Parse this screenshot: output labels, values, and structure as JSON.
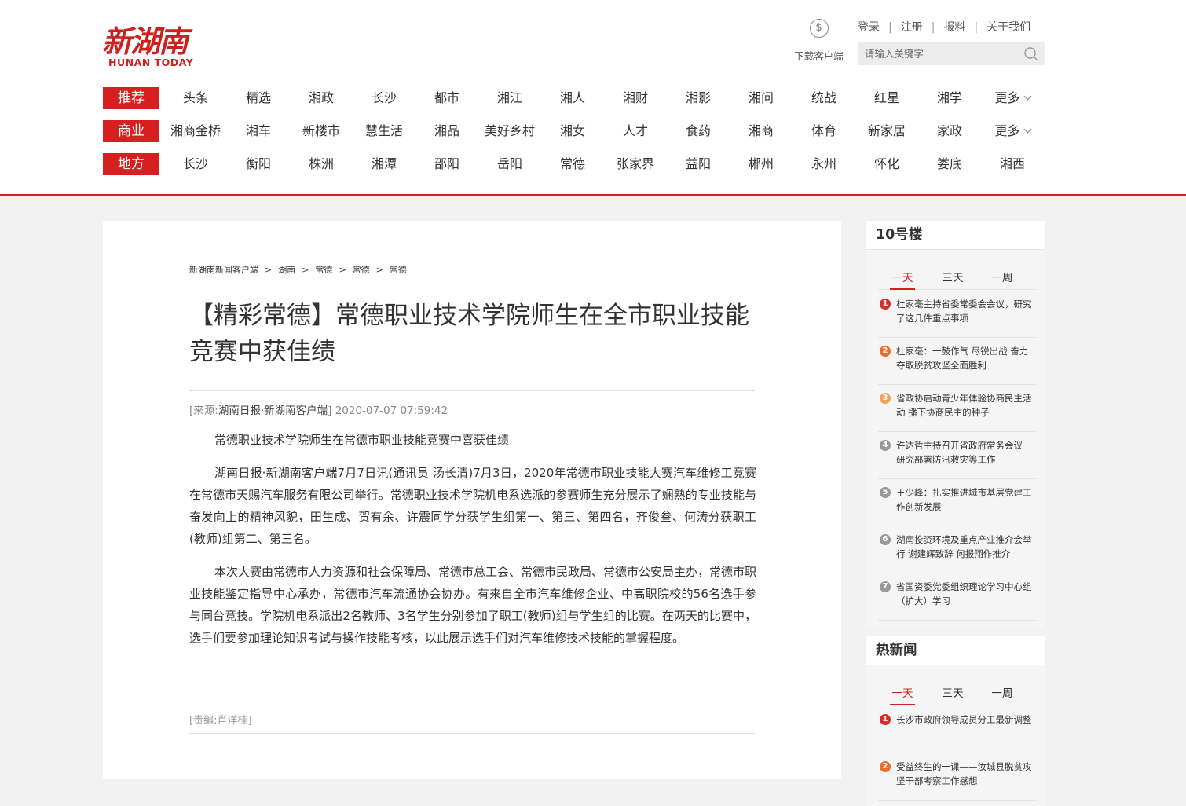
{
  "logo": {
    "text": "新湖南",
    "sub": "HUNAN TODAY"
  },
  "header": {
    "download_label": "下载客户端",
    "links": [
      "登录",
      "注册",
      "报料",
      "关于我们"
    ],
    "search_placeholder": "请输入关键字"
  },
  "nav_rows": [
    {
      "label": "推荐",
      "items": [
        "头条",
        "精选",
        "湘政",
        "长沙",
        "都市",
        "湘江",
        "湘人",
        "湘财",
        "湘影",
        "湘问",
        "统战",
        "红星",
        "湘学",
        "更多"
      ]
    },
    {
      "label": "商业",
      "items": [
        "湘商金桥",
        "湘车",
        "新楼市",
        "慧生活",
        "湘品",
        "美好乡村",
        "湘女",
        "人才",
        "食药",
        "湘商",
        "体育",
        "新家居",
        "家政",
        "更多"
      ]
    },
    {
      "label": "地方",
      "items": [
        "长沙",
        "衡阳",
        "株洲",
        "湘潭",
        "邵阳",
        "岳阳",
        "常德",
        "张家界",
        "益阳",
        "郴州",
        "永州",
        "怀化",
        "娄底",
        "湘西"
      ]
    }
  ],
  "article": {
    "breadcrumb": [
      "新湖南新闻客户端",
      "湖南",
      "常德",
      "常德",
      "常德"
    ],
    "breadcrumb_sep": ">",
    "title": "【精彩常德】常德职业技术学院师生在全市职业技能竞赛中获佳绩",
    "source_prefix": "[来源:",
    "source_name": "湖南日报·新湖南客户端",
    "source_suffix": "]",
    "datetime": "2020-07-07 07:59:42",
    "paragraphs": [
      "常德职业技术学院师生在常德市职业技能竞赛中喜获佳绩",
      "湖南日报·新湖南客户端7月7日讯(通讯员 汤长清)7月3日，2020年常德市职业技能大赛汽车维修工竞赛在常德市天赐汽车服务有限公司举行。常德职业技术学院机电系选派的参赛师生充分展示了娴熟的专业技能与奋发向上的精神风貌，田生成、贺有余、许震同学分获学生组第一、第三、第四名，齐俊叁、何涛分获职工(教师)组第二、第三名。",
      "本次大赛由常德市人力资源和社会保障局、常德市总工会、常德市民政局、常德市公安局主办，常德市职业技能鉴定指导中心承办，常德市汽车流通协会协办。有来自全市汽车维修企业、中高职院校的56名选手参与同台竞技。学院机电系派出2名教师、3名学生分别参加了职工(教师)组与学生组的比赛。在两天的比赛中，选手们要参加理论知识考试与操作技能考核，以此展示选手们对汽车维修技术技能的掌握程度。"
    ],
    "editor": "[责编:肖洋桂]"
  },
  "sidebar": {
    "box1": {
      "title": "10号楼",
      "tabs": [
        "一天",
        "三天",
        "一周"
      ],
      "items": [
        {
          "num": "1",
          "text": "杜家毫主持省委常委会会议，研究了这几件重点事项"
        },
        {
          "num": "2",
          "text": "杜家毫：一鼓作气 尽锐出战 奋力夺取脱贫攻坚全面胜利"
        },
        {
          "num": "3",
          "text": "省政协启动青少年体验协商民主活动 播下协商民主的种子"
        },
        {
          "num": "4",
          "text": "许达哲主持召开省政府常务会议 研究部署防汛救灾等工作"
        },
        {
          "num": "5",
          "text": "王少峰：扎实推进城市基层党建工作创新发展"
        },
        {
          "num": "6",
          "text": "湖南投资环境及重点产业推介会举行 谢建辉致辞 何报翔作推介"
        },
        {
          "num": "7",
          "text": "省国资委党委组织理论学习中心组（扩大）学习"
        }
      ]
    },
    "box2": {
      "title": "热新闻",
      "tabs": [
        "一天",
        "三天",
        "一周"
      ],
      "items": [
        {
          "num": "1",
          "text": "长沙市政府领导成员分工最新调整"
        },
        {
          "num": "2",
          "text": "受益终生的一课——汝城县脱贫攻坚干部考察工作感想"
        }
      ]
    }
  },
  "colors": {
    "brand_red": "#d71f1f",
    "rank1": "#e02a2a",
    "rank2": "#f06a2a",
    "rank3": "#f3a05a",
    "rank_other": "#9a9a9a"
  },
  "icons": {
    "download": "download-icon",
    "search": "search-icon",
    "more": "chevron-down-icon"
  }
}
